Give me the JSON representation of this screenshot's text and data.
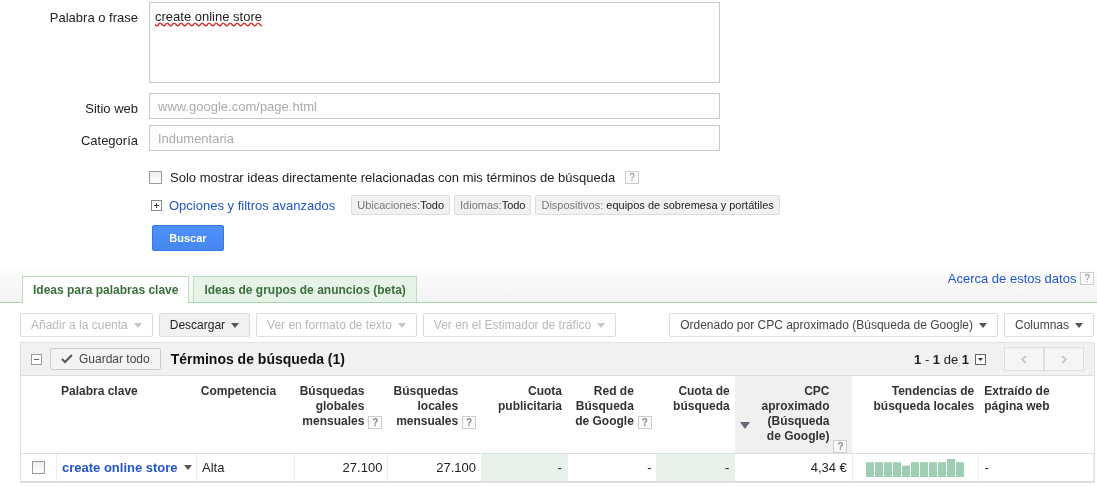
{
  "form": {
    "phrase_label": "Palabra o frase",
    "phrase_value": "create online store",
    "website_label": "Sitio web",
    "website_placeholder": "www.google.com/page.html",
    "category_label": "Categoría",
    "category_placeholder": "Indumentaria",
    "only_related": {
      "label": "Solo mostrar ideas directamente relacionadas con mis términos de búsqueda",
      "checked": false,
      "help": "?"
    },
    "advanced_link": "Opciones y filtros avanzados",
    "filters": [
      {
        "label": "Ubicaciones:",
        "value": "Todo"
      },
      {
        "label": "Idiomas:",
        "value": "Todo"
      },
      {
        "label": "Dispositivos:",
        "value": " equipos de sobremesa y portátiles"
      }
    ],
    "search_button": "Buscar"
  },
  "tabs": [
    {
      "label": "Ideas para palabras clave",
      "selected": true
    },
    {
      "label": "Ideas de grupos de anuncios (beta)",
      "selected": false
    }
  ],
  "about_link": {
    "label": "Acerca de estos datos",
    "help": "?"
  },
  "toolbar": {
    "left": [
      {
        "label": "Añadir a la cuenta",
        "disabled": true
      },
      {
        "label": "Descargar",
        "disabled": false
      },
      {
        "label": "Ver en formato de texto",
        "disabled": true
      },
      {
        "label": "Ver en el Estimador de tráfico",
        "disabled": true
      }
    ],
    "right": [
      {
        "label": "Ordenado por CPC aproximado (Búsqueda de Google)",
        "disabled": false
      },
      {
        "label": "Columnas",
        "disabled": false
      }
    ]
  },
  "table": {
    "save_all": "Guardar todo",
    "title": "Términos de búsqueda (1)",
    "pagination": "**1** - **1** de **1**",
    "columns": [
      {
        "label": "Palabra clave",
        "kind": "keyword",
        "sorted": false,
        "shaded": false
      },
      {
        "label": "Competencia",
        "kind": "text",
        "sorted": false,
        "shaded": false
      },
      {
        "label": "Búsquedas globales mensuales",
        "kind": "number",
        "help": "?",
        "sorted": false,
        "shaded": false
      },
      {
        "label": "Búsquedas locales mensuales",
        "kind": "number",
        "help": "?",
        "sorted": false,
        "shaded": false
      },
      {
        "label": "Cuota publicitaria",
        "kind": "number",
        "sorted": false,
        "shaded": true
      },
      {
        "label": "Red de Búsqueda de Google",
        "kind": "number",
        "help": "?",
        "sorted": false,
        "shaded": false
      },
      {
        "label": "Cuota de búsqueda",
        "kind": "number",
        "sorted": false,
        "shaded": true
      },
      {
        "label": "CPC aproximado (Búsqueda de Google)",
        "kind": "number",
        "help": "?",
        "sorted": true,
        "shaded": false
      },
      {
        "label": "Tendencias de búsqueda locales",
        "kind": "trend",
        "sorted": false,
        "shaded": false
      },
      {
        "label": "Extraído de página web",
        "kind": "text",
        "sorted": false,
        "shaded": false
      }
    ],
    "rows": [
      {
        "checked": false,
        "cells": [
          "create online store",
          "Alta",
          "27.100",
          "27.100",
          "-",
          "-",
          "-",
          "4,34 €",
          "",
          "-"
        ]
      }
    ]
  }
}
